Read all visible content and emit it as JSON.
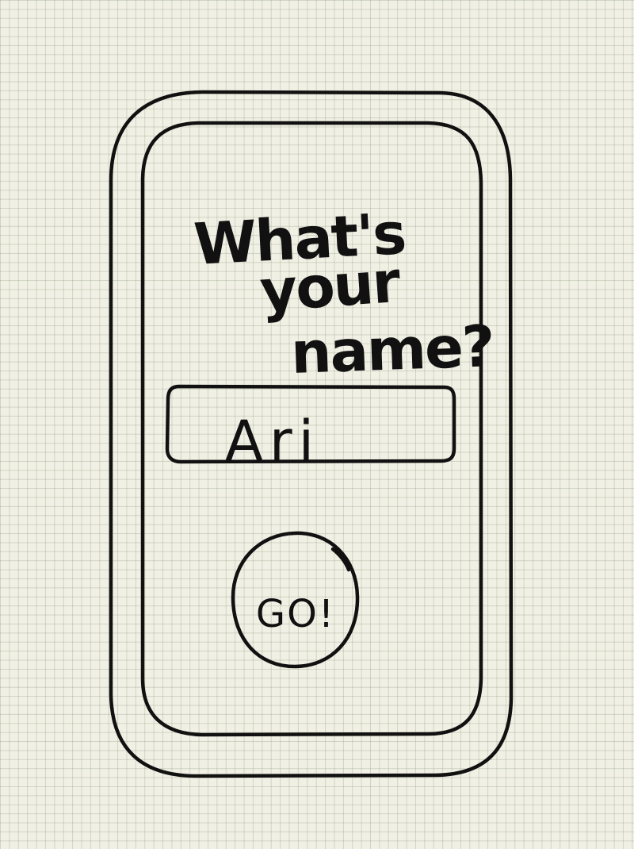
{
  "prompt": {
    "line1": "What's",
    "line2": "your",
    "line3": "name?"
  },
  "name_input": {
    "value": "Ari"
  },
  "go_button": {
    "label": "GO!"
  }
}
